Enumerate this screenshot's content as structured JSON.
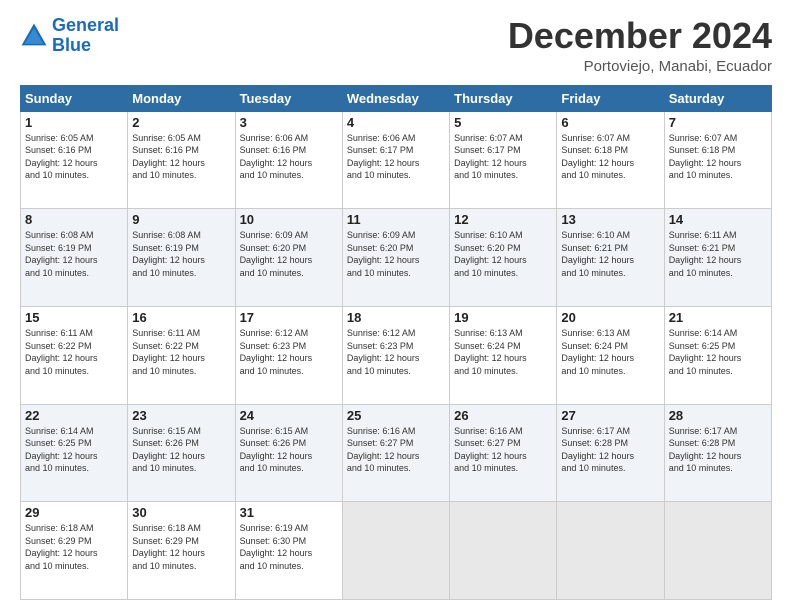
{
  "logo": {
    "line1": "General",
    "line2": "Blue"
  },
  "header": {
    "month": "December 2024",
    "location": "Portoviejo, Manabi, Ecuador"
  },
  "days_of_week": [
    "Sunday",
    "Monday",
    "Tuesday",
    "Wednesday",
    "Thursday",
    "Friday",
    "Saturday"
  ],
  "weeks": [
    [
      {
        "day": "1",
        "sunrise": "6:05 AM",
        "sunset": "6:16 PM",
        "daylight": "12 hours and 10 minutes."
      },
      {
        "day": "2",
        "sunrise": "6:05 AM",
        "sunset": "6:16 PM",
        "daylight": "12 hours and 10 minutes."
      },
      {
        "day": "3",
        "sunrise": "6:06 AM",
        "sunset": "6:16 PM",
        "daylight": "12 hours and 10 minutes."
      },
      {
        "day": "4",
        "sunrise": "6:06 AM",
        "sunset": "6:17 PM",
        "daylight": "12 hours and 10 minutes."
      },
      {
        "day": "5",
        "sunrise": "6:07 AM",
        "sunset": "6:17 PM",
        "daylight": "12 hours and 10 minutes."
      },
      {
        "day": "6",
        "sunrise": "6:07 AM",
        "sunset": "6:18 PM",
        "daylight": "12 hours and 10 minutes."
      },
      {
        "day": "7",
        "sunrise": "6:07 AM",
        "sunset": "6:18 PM",
        "daylight": "12 hours and 10 minutes."
      }
    ],
    [
      {
        "day": "8",
        "sunrise": "6:08 AM",
        "sunset": "6:19 PM",
        "daylight": "12 hours and 10 minutes."
      },
      {
        "day": "9",
        "sunrise": "6:08 AM",
        "sunset": "6:19 PM",
        "daylight": "12 hours and 10 minutes."
      },
      {
        "day": "10",
        "sunrise": "6:09 AM",
        "sunset": "6:20 PM",
        "daylight": "12 hours and 10 minutes."
      },
      {
        "day": "11",
        "sunrise": "6:09 AM",
        "sunset": "6:20 PM",
        "daylight": "12 hours and 10 minutes."
      },
      {
        "day": "12",
        "sunrise": "6:10 AM",
        "sunset": "6:20 PM",
        "daylight": "12 hours and 10 minutes."
      },
      {
        "day": "13",
        "sunrise": "6:10 AM",
        "sunset": "6:21 PM",
        "daylight": "12 hours and 10 minutes."
      },
      {
        "day": "14",
        "sunrise": "6:11 AM",
        "sunset": "6:21 PM",
        "daylight": "12 hours and 10 minutes."
      }
    ],
    [
      {
        "day": "15",
        "sunrise": "6:11 AM",
        "sunset": "6:22 PM",
        "daylight": "12 hours and 10 minutes."
      },
      {
        "day": "16",
        "sunrise": "6:11 AM",
        "sunset": "6:22 PM",
        "daylight": "12 hours and 10 minutes."
      },
      {
        "day": "17",
        "sunrise": "6:12 AM",
        "sunset": "6:23 PM",
        "daylight": "12 hours and 10 minutes."
      },
      {
        "day": "18",
        "sunrise": "6:12 AM",
        "sunset": "6:23 PM",
        "daylight": "12 hours and 10 minutes."
      },
      {
        "day": "19",
        "sunrise": "6:13 AM",
        "sunset": "6:24 PM",
        "daylight": "12 hours and 10 minutes."
      },
      {
        "day": "20",
        "sunrise": "6:13 AM",
        "sunset": "6:24 PM",
        "daylight": "12 hours and 10 minutes."
      },
      {
        "day": "21",
        "sunrise": "6:14 AM",
        "sunset": "6:25 PM",
        "daylight": "12 hours and 10 minutes."
      }
    ],
    [
      {
        "day": "22",
        "sunrise": "6:14 AM",
        "sunset": "6:25 PM",
        "daylight": "12 hours and 10 minutes."
      },
      {
        "day": "23",
        "sunrise": "6:15 AM",
        "sunset": "6:26 PM",
        "daylight": "12 hours and 10 minutes."
      },
      {
        "day": "24",
        "sunrise": "6:15 AM",
        "sunset": "6:26 PM",
        "daylight": "12 hours and 10 minutes."
      },
      {
        "day": "25",
        "sunrise": "6:16 AM",
        "sunset": "6:27 PM",
        "daylight": "12 hours and 10 minutes."
      },
      {
        "day": "26",
        "sunrise": "6:16 AM",
        "sunset": "6:27 PM",
        "daylight": "12 hours and 10 minutes."
      },
      {
        "day": "27",
        "sunrise": "6:17 AM",
        "sunset": "6:28 PM",
        "daylight": "12 hours and 10 minutes."
      },
      {
        "day": "28",
        "sunrise": "6:17 AM",
        "sunset": "6:28 PM",
        "daylight": "12 hours and 10 minutes."
      }
    ],
    [
      {
        "day": "29",
        "sunrise": "6:18 AM",
        "sunset": "6:29 PM",
        "daylight": "12 hours and 10 minutes."
      },
      {
        "day": "30",
        "sunrise": "6:18 AM",
        "sunset": "6:29 PM",
        "daylight": "12 hours and 10 minutes."
      },
      {
        "day": "31",
        "sunrise": "6:19 AM",
        "sunset": "6:30 PM",
        "daylight": "12 hours and 10 minutes."
      },
      null,
      null,
      null,
      null
    ]
  ]
}
